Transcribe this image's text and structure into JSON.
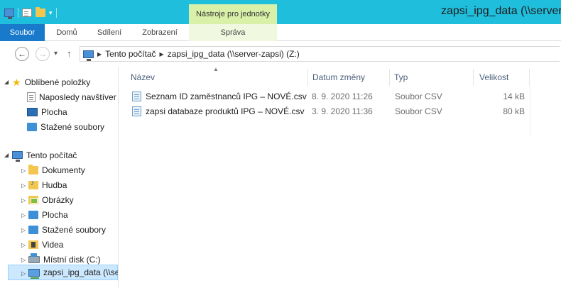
{
  "window": {
    "title": "zapsi_ipg_data (\\\\server-z",
    "context_tab_group": "Nástroje pro jednotky"
  },
  "ribbon": {
    "tabs": [
      "Soubor",
      "Domů",
      "Sdílení",
      "Zobrazení",
      "Správa"
    ]
  },
  "address": {
    "crumbs": [
      "Tento počítač",
      "zapsi_ipg_data (\\\\server-zapsi) (Z:)"
    ]
  },
  "nav": {
    "favorites_label": "Oblíbené položky",
    "favorites": [
      "Naposledy navštíver",
      "Plocha",
      "Stažené soubory"
    ],
    "computer_label": "Tento počítač",
    "computer_items": [
      "Dokumenty",
      "Hudba",
      "Obrázky",
      "Plocha",
      "Stažené soubory",
      "Videa",
      "Místní disk (C:)",
      "zapsi_ipg_data (\\\\ser"
    ]
  },
  "list": {
    "columns": [
      "Název",
      "Datum změny",
      "Typ",
      "Velikost"
    ],
    "files": [
      {
        "name": "Seznam ID zaměstnanců IPG – NOVÉ.csv",
        "modified": "8. 9. 2020 11:26",
        "type": "Soubor CSV",
        "size": "14 kB"
      },
      {
        "name": "zapsi databaze produktů IPG – NOVÉ.csv",
        "modified": "3. 9. 2020 11:36",
        "type": "Soubor CSV",
        "size": "80 kB"
      }
    ]
  },
  "colors": {
    "titlebar": "#1fbedc",
    "context_tab": "#d8f0a8",
    "file_tab": "#1979ca",
    "selection": "#cce8ff"
  },
  "icons": {
    "favorites": "star-icon",
    "computer": "computer-icon",
    "network_drive": "network-drive-icon",
    "file": "csv-file-icon"
  }
}
